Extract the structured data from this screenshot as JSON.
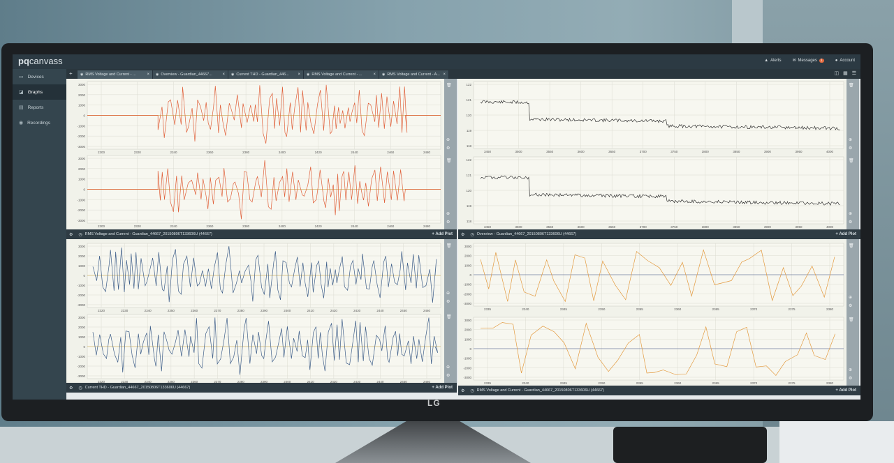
{
  "app": {
    "logo_bold": "pq",
    "logo_rest": "canvass",
    "monitor_brand": "LG"
  },
  "header": {
    "alerts": "Alerts",
    "messages": "Messages",
    "messages_count": "1",
    "account": "Account"
  },
  "sidebar": {
    "items": [
      {
        "icon": "devices-icon",
        "label": "Devices"
      },
      {
        "icon": "graphs-icon",
        "label": "Graphs",
        "active": true
      },
      {
        "icon": "reports-icon",
        "label": "Reports"
      },
      {
        "icon": "recordings-icon",
        "label": "Recordings"
      }
    ]
  },
  "tabs": [
    {
      "label": "RMS Voltage and Current - ..."
    },
    {
      "label": "Overview - Guardian_44667..."
    },
    {
      "label": "Current THD - Guardian_446..."
    },
    {
      "label": "RMS Voltage and Current - ..."
    },
    {
      "label": "RMS Voltage and Current - A..."
    }
  ],
  "panels": {
    "top_left": {
      "title": "RMS Voltage and Current - Guardian_44667_20150806T133606U (44667)",
      "add_plot": "+ Add Plot"
    },
    "top_right": {
      "title": "Overview - Guardian_44667_20150806T133606U (44667)",
      "add_plot": "+ Add Plot"
    },
    "bottom_left": {
      "title": "Current THD - Guardian_44667_20150806T133606U (44667)",
      "add_plot": "+ Add Plot"
    },
    "bottom_right": {
      "title": "RMS Voltage and Current - Guardian_44667_20150806T133606U (44667)",
      "add_plot": "+ Add Plot"
    }
  },
  "charts": {
    "tl1": {
      "yticks": [
        "3000",
        "2000",
        "1000",
        "0",
        "-1000",
        "-2000",
        "-3000"
      ],
      "xticks": [
        "2300",
        "2320",
        "2340",
        "2360",
        "2380",
        "2400",
        "2420",
        "2440",
        "2460",
        "2480"
      ],
      "color": "#e0603a"
    },
    "tl2": {
      "yticks": [
        "3000",
        "2000",
        "1000",
        "0",
        "-1000",
        "-2000",
        "-3000"
      ],
      "xticks": [
        "2300",
        "2320",
        "2340",
        "2360",
        "2380",
        "2400",
        "2420",
        "2440",
        "2460",
        "2480"
      ],
      "color": "#e0603a"
    },
    "tr1": {
      "yticks": [
        "122",
        "121",
        "120",
        "119",
        "118"
      ],
      "xticks": [
        "3450",
        "3500",
        "3550",
        "3600",
        "3650",
        "3700",
        "3750",
        "3800",
        "3850",
        "3900",
        "3950",
        "4000"
      ],
      "color": "#333333"
    },
    "tr2": {
      "yticks": [
        "122",
        "121",
        "120",
        "119",
        "118"
      ],
      "xticks": [
        "3450",
        "3500",
        "3550",
        "3600",
        "3650",
        "3700",
        "3750",
        "3800",
        "3850",
        "3900",
        "3950",
        "4000"
      ],
      "color": "#333333"
    },
    "bl1": {
      "yticks": [
        "3000",
        "2000",
        "1000",
        "0",
        "-1000",
        "-2000",
        "-3000"
      ],
      "xticks": [
        "2320",
        "2330",
        "2340",
        "2350",
        "2360",
        "2370",
        "2380",
        "2390",
        "2400",
        "2410",
        "2420",
        "2430",
        "2440",
        "2450",
        "2460"
      ],
      "color": "#3f5f8a"
    },
    "bl2": {
      "yticks": [
        "3000",
        "2000",
        "1000",
        "0",
        "-1000",
        "-2000",
        "-3000"
      ],
      "xticks": [
        "2320",
        "2330",
        "2340",
        "2350",
        "2360",
        "2370",
        "2380",
        "2390",
        "2400",
        "2410",
        "2420",
        "2430",
        "2440",
        "2450",
        "2460"
      ],
      "color": "#3f5f8a"
    },
    "br1": {
      "yticks": [
        "3000",
        "2000",
        "1000",
        "0",
        "-1000",
        "-2000",
        "-3000"
      ],
      "xticks": [
        "2335",
        "2340",
        "2345",
        "2350",
        "2355",
        "2360",
        "2365",
        "2370",
        "2375",
        "2380"
      ],
      "color": "#e39a3f"
    },
    "br2": {
      "yticks": [
        "3000",
        "2000",
        "1000",
        "0",
        "-1000",
        "-2000",
        "-3000"
      ],
      "xticks": [
        "2335",
        "2340",
        "2345",
        "2350",
        "2355",
        "2360",
        "2365",
        "2370",
        "2375",
        "2380"
      ],
      "color": "#e39a3f"
    }
  }
}
